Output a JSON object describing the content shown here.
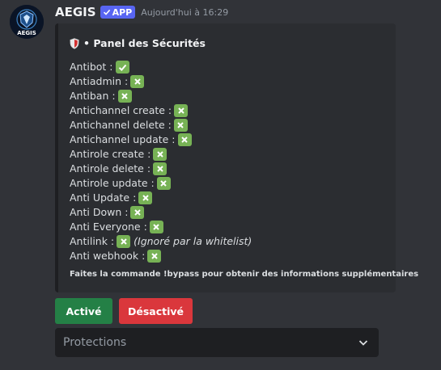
{
  "author": {
    "name": "AEGIS",
    "badge": "APP",
    "timestamp": "Aujourd'hui à 16:29",
    "avatar_text": "AEGIS"
  },
  "embed": {
    "title": "• Panel des Sécurités",
    "lines": [
      {
        "label": "Antibot :",
        "status": "check"
      },
      {
        "label": "Antiadmin :",
        "status": "cross"
      },
      {
        "label": "Antiban :",
        "status": "cross"
      },
      {
        "label": "Antichannel create :",
        "status": "cross"
      },
      {
        "label": "Antichannel delete :",
        "status": "cross"
      },
      {
        "label": "Antichannel update :",
        "status": "cross"
      },
      {
        "label": "Antirole create :",
        "status": "cross"
      },
      {
        "label": "Antirole delete :",
        "status": "cross"
      },
      {
        "label": "Antirole update :",
        "status": "cross"
      },
      {
        "label": "Anti Update :",
        "status": "cross"
      },
      {
        "label": "Anti Down :",
        "status": "cross"
      },
      {
        "label": "Anti Everyone :",
        "status": "cross"
      },
      {
        "label": "Antilink :",
        "status": "cross",
        "note": "(Ignoré par la whitelist)"
      },
      {
        "label": "Anti webhook :",
        "status": "cross"
      }
    ],
    "footer": "Faites la commande !bypass pour obtenir des informations supplémentaires"
  },
  "buttons": {
    "enable_label": "Activé",
    "disable_label": "Désactivé"
  },
  "select": {
    "placeholder": "Protections"
  },
  "colors": {
    "background": "#313338",
    "embed": "#2b2d31",
    "brand": "#5865f2",
    "success": "#248046",
    "danger": "#da373c",
    "emoji_green": "#77b255"
  }
}
